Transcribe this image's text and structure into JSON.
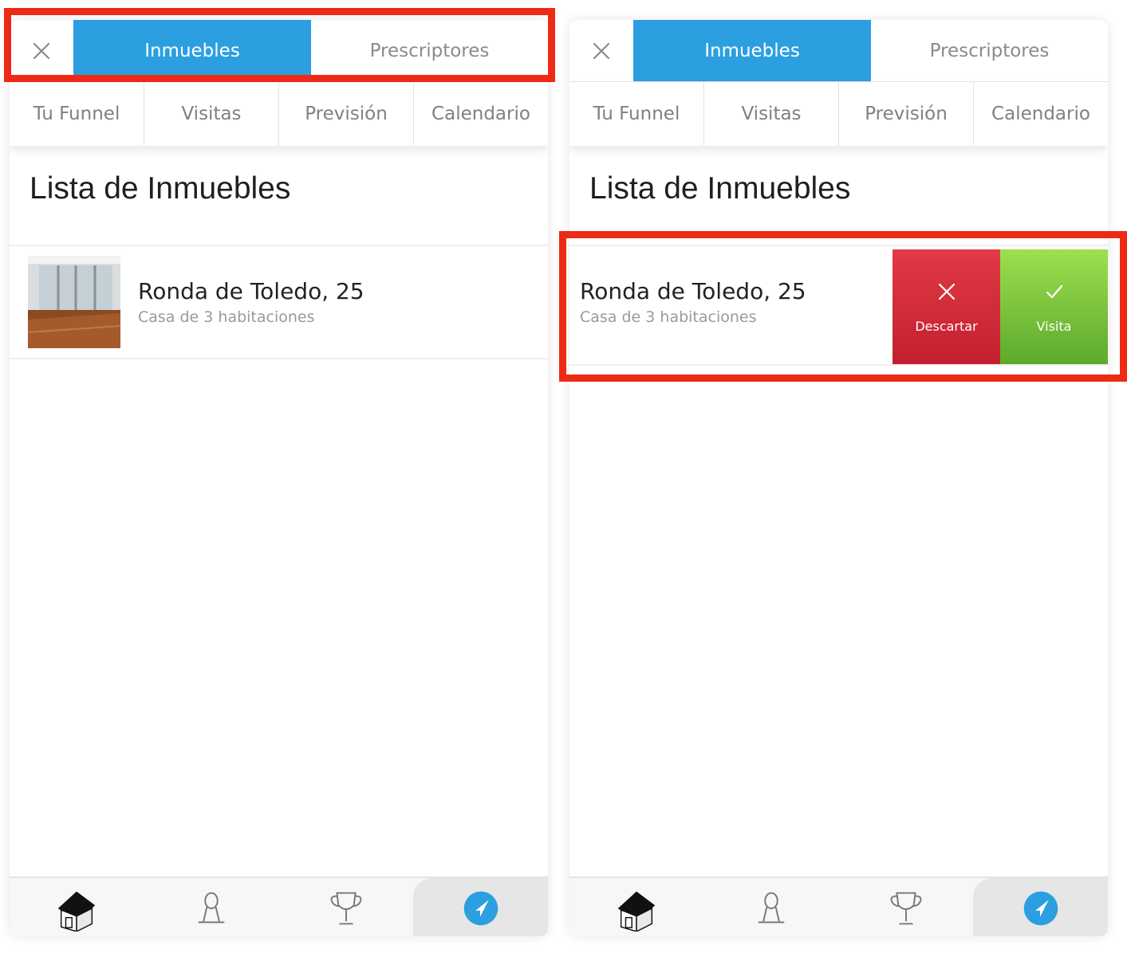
{
  "segmented_control": {
    "close_icon": "close-icon",
    "tabs": [
      "Inmuebles",
      "Prescriptores"
    ],
    "active_tab": "Inmuebles",
    "active_color": "#2b9fe0"
  },
  "sub_tabs": [
    "Tu Funnel",
    "Visitas",
    "Previsión",
    "Calendario"
  ],
  "section_title": "Lista de Inmuebles",
  "property": {
    "title": "Ronda de Toledo, 25",
    "subtitle": "Casa de 3 habitaciones",
    "thumbnail": "empty-room-photo"
  },
  "swipe_actions": {
    "discard_label": "Descartar",
    "discard_icon": "close-icon",
    "discard_color": "#d12b3a",
    "visit_label": "Visita",
    "visit_icon": "checkmark-icon",
    "visit_color": "#7cc63d"
  },
  "bottom_tabs": [
    "house-icon",
    "person-icon",
    "trophy-icon",
    "navigation-icon"
  ],
  "active_bottom_tab": "navigation-icon",
  "highlight_color": "#ee2a14"
}
